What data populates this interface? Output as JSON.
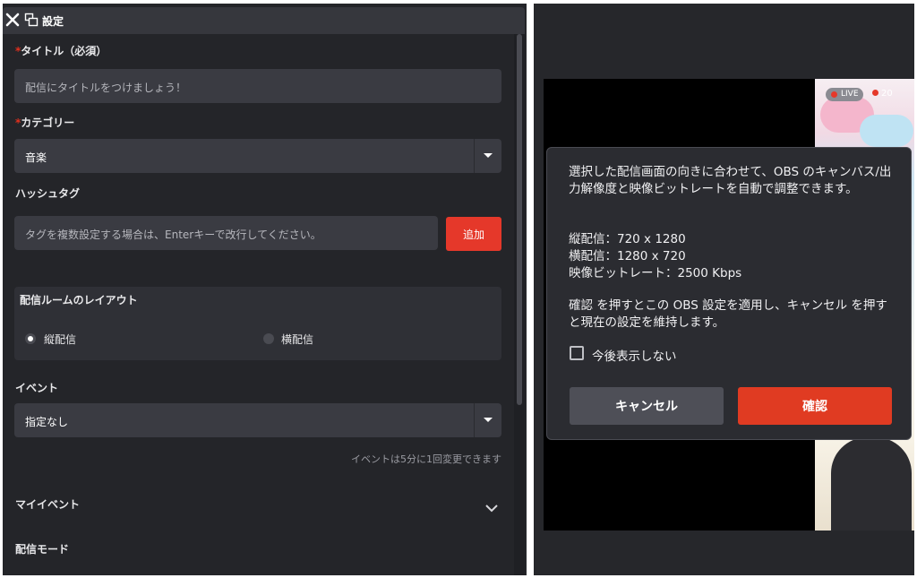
{
  "window": {
    "title": "設定"
  },
  "form": {
    "title_label": "タイトル（必須）",
    "title_required_mark": "*",
    "title_placeholder": "配信にタイトルをつけましょう！",
    "category_label": "カテゴリー",
    "category_required_mark": "*",
    "category_value": "音楽",
    "hashtag_label": "ハッシュタグ",
    "hashtag_placeholder": "タグを複数設定する場合は、Enterキーで改行してください。",
    "add_button": "追加",
    "layout": {
      "label": "配信ルームのレイアウト",
      "options": [
        {
          "label": "縦配信",
          "selected": true
        },
        {
          "label": "横配信",
          "selected": false
        }
      ]
    },
    "event_label": "イベント",
    "event_value": "指定なし",
    "event_note": "イベントは5分に1回変更できます",
    "my_event_label": "マイイベント",
    "stream_mode_label": "配信モード"
  },
  "preview": {
    "live_badge": "LIVE",
    "viewer_count": "20"
  },
  "dialog": {
    "message_line1": "選択した配信画面の向きに合わせて、OBS のキャンバス/出力解像度と映像ビットレートを自動で調整できます。",
    "spec_portrait": "縦配信：720 x 1280",
    "spec_landscape": "横配信：1280 x 720",
    "spec_bitrate": "映像ビットレート：2500 Kbps",
    "message_line2": "確認 を押すとこの OBS 設定を適用し、キャンセル を押すと現在の設定を維持します。",
    "dont_show_label": "今後表示しない",
    "dont_show_checked": false,
    "cancel_button": "キャンセル",
    "confirm_button": "確認"
  },
  "colors": {
    "accent": "#e5382a",
    "panel": "#242529",
    "field": "#3a3b42"
  }
}
